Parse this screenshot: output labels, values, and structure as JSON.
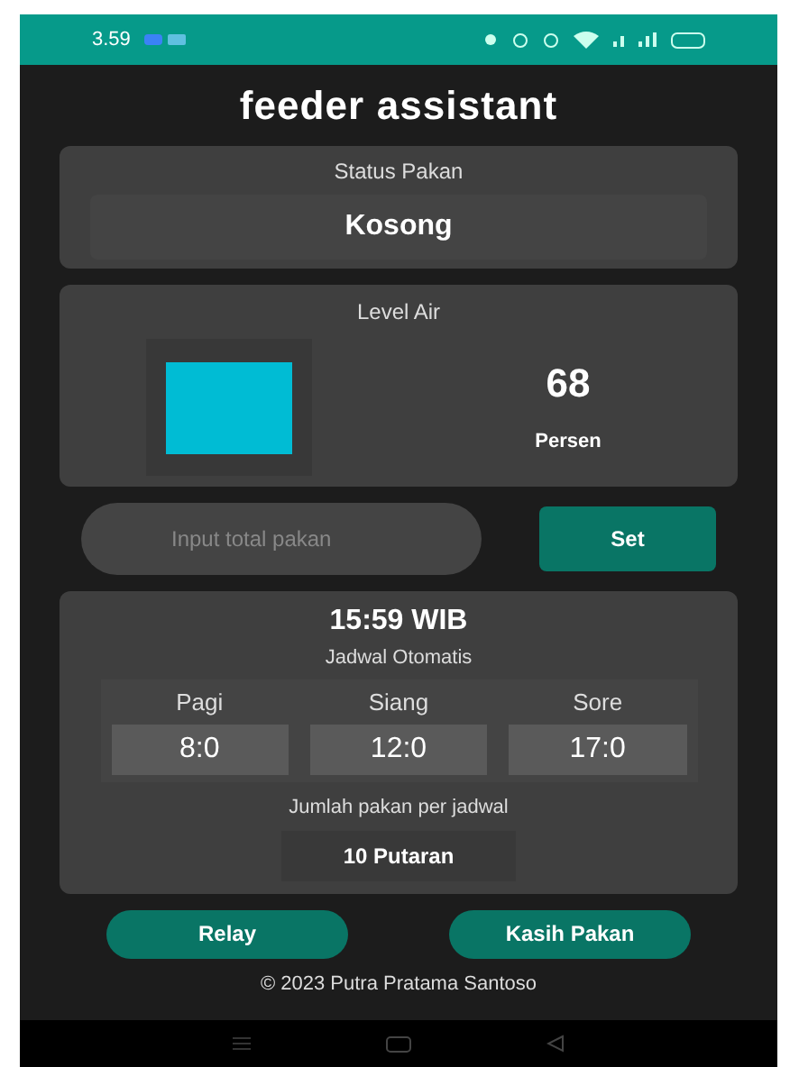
{
  "status_bar": {
    "time": "3.59"
  },
  "app": {
    "title": "feeder assistant"
  },
  "status_pakan": {
    "label": "Status Pakan",
    "value": "Kosong"
  },
  "level_air": {
    "label": "Level Air",
    "value": "68",
    "unit": "Persen"
  },
  "input": {
    "placeholder": "Input total pakan",
    "button": "Set"
  },
  "schedule": {
    "clock": "15:59 WIB",
    "subtitle": "Jadwal Otomatis",
    "slots": [
      {
        "label": "Pagi",
        "time": "8:0"
      },
      {
        "label": "Siang",
        "time": "12:0"
      },
      {
        "label": "Sore",
        "time": "17:0"
      }
    ],
    "amount_label": "Jumlah pakan per jadwal",
    "amount": "10 Putaran"
  },
  "buttons": [
    "Relay",
    "Kasih Pakan"
  ],
  "footer": "© 2023 Putra Pratama Santoso"
}
